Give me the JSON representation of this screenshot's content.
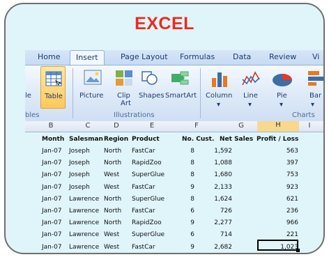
{
  "title": "EXCEL",
  "tabs": [
    "Home",
    "Insert",
    "Page Layout",
    "Formulas",
    "Data",
    "Review",
    "Vi"
  ],
  "ribbon": {
    "table_partial": "le",
    "table": "Table",
    "picture": "Picture",
    "clip_art_1": "Clip",
    "clip_art_2": "Art",
    "shapes": "Shapes",
    "smartart": "SmartArt",
    "column": "Column",
    "line": "Line",
    "pie": "Pie",
    "bar": "Bar",
    "group_tables": "bles",
    "group_illustrations": "Illustrations",
    "group_charts": "Charts"
  },
  "columns": [
    "B",
    "C",
    "D",
    "E",
    "F",
    "G",
    "H",
    "I"
  ],
  "headers": [
    "Month",
    "Salesman",
    "Region",
    "Product",
    "No. Cust.",
    "Net Sales",
    "Profit / Loss"
  ],
  "rows": [
    [
      "Jan-07",
      "Joseph",
      "North",
      "FastCar",
      "8",
      "1,592",
      "563"
    ],
    [
      "Jan-07",
      "Joseph",
      "North",
      "RapidZoo",
      "8",
      "1,088",
      "397"
    ],
    [
      "Jan-07",
      "Joseph",
      "West",
      "SuperGlue",
      "8",
      "1,680",
      "753"
    ],
    [
      "Jan-07",
      "Joseph",
      "West",
      "FastCar",
      "9",
      "2,133",
      "923"
    ],
    [
      "Jan-07",
      "Lawrence",
      "North",
      "SuperGlue",
      "8",
      "1,624",
      "621"
    ],
    [
      "Jan-07",
      "Lawrence",
      "North",
      "FastCar",
      "6",
      "726",
      "236"
    ],
    [
      "Jan-07",
      "Lawrence",
      "North",
      "RapidZoo",
      "9",
      "2,277",
      "966"
    ],
    [
      "Jan-07",
      "Lawrence",
      "West",
      "SuperGlue",
      "6",
      "714",
      "221"
    ],
    [
      "Jan-07",
      "Lawrence",
      "West",
      "FastCar",
      "9",
      "2,682",
      "1,023"
    ]
  ]
}
